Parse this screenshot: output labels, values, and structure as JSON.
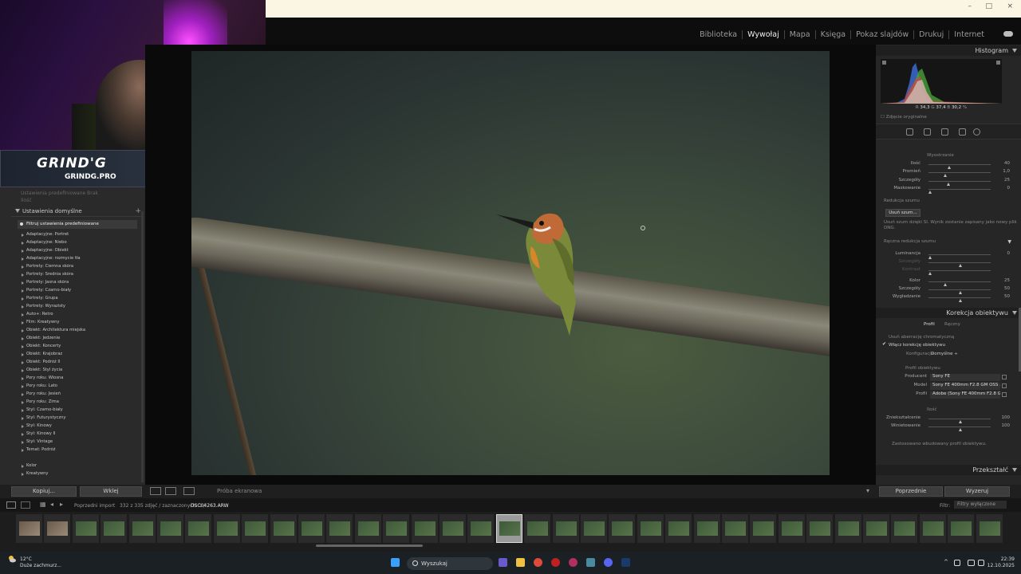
{
  "window": {
    "controls": [
      "–",
      "□",
      "×"
    ]
  },
  "modules": {
    "items": [
      "Biblioteka",
      "Wywołaj",
      "Mapa",
      "Księga",
      "Pokaz slajdów",
      "Drukuj",
      "Internet"
    ],
    "active": "Wywołaj"
  },
  "overlay": {
    "logo_big": "GRIND'G",
    "logo_small": "GRINDG.PRO"
  },
  "left_panel": {
    "faded_rows": [
      "Ustawienia predefiniowane   Brak",
      "Ilość"
    ],
    "presets_header": "Ustawienia domyślne",
    "add_symbol": "+",
    "filter_label": "Filtruj ustawienia predefiniowane",
    "presets": [
      "Adaptacyjne: Portret",
      "Adaptacyjne: Niebo",
      "Adaptacyjne: Obiekt",
      "Adaptacyjne: rozmycie tła",
      "Portrety: Ciemna skóra",
      "Portrety: Średnia skóra",
      "Portrety: Jasna skóra",
      "Portrety: Czarno-biały",
      "Portrety: Grupa",
      "Portrety: Wyrazisty",
      "Auto+: Retro",
      "Film: Kreatywny",
      "Obiekt: Architektura miejska",
      "Obiekt: Jedzenie",
      "Obiekt: Koncerty",
      "Obiekt: Krajobraz",
      "Obiekt: Podróż II",
      "Obiekt: Styl życia",
      "Pory roku: Wiosna",
      "Pory roku: Lato",
      "Pory roku: Jesień",
      "Pory roku: Zima",
      "Styl: Czarno-biały",
      "Styl: Futurystyczny",
      "Styl: Kinowy",
      "Styl: Kinowy II",
      "Styl: Vintage",
      "Temat: Podróż",
      "",
      "Kolor",
      "Kreatywny"
    ],
    "copy_button": "Kopiuj...",
    "paste_button": "Wklej"
  },
  "toolbar": {
    "soft_proof": "Próba ekranowa"
  },
  "right_panel": {
    "histogram_title": "Histogram",
    "rgb": {
      "r_label": "R",
      "r": "34,3",
      "g_label": "G",
      "g": "37,4",
      "b_label": "B",
      "b": "30,2",
      "unit": "%"
    },
    "original_photo": "Zdjęcie oryginalne",
    "sharpen_title": "Wyostrzanie",
    "sharpen": [
      {
        "name": "Ilość",
        "value": "40",
        "pos": 0.31
      },
      {
        "name": "Promień",
        "value": "1,0",
        "pos": 0.25
      },
      {
        "name": "Szczegóły",
        "value": "25",
        "pos": 0.3
      },
      {
        "name": "Maskowanie",
        "value": "0",
        "pos": 0.0
      }
    ],
    "noise_title": "Redukcja szumu",
    "denoise_button": "Usuń szum...",
    "denoise_note": "Usuń szum dzięki SI. Wynik zostanie zapisany jako nowy plik DNG.",
    "manual_noise": "Ręczna redukcja szumu",
    "noise": [
      {
        "name": "Luminancja",
        "value": "0",
        "pos": 0.0,
        "dim": false
      },
      {
        "name": "Szczegóły",
        "value": "",
        "pos": 0.5,
        "dim": true
      },
      {
        "name": "Kontrast",
        "value": "",
        "pos": 0.0,
        "dim": true
      },
      {
        "name": "Kolor",
        "value": "25",
        "pos": 0.25,
        "dim": false
      },
      {
        "name": "Szczegóły",
        "value": "50",
        "pos": 0.5,
        "dim": false
      },
      {
        "name": "Wygładzanie",
        "value": "50",
        "pos": 0.5,
        "dim": false
      }
    ],
    "lens_title": "Korekcja obiektywu",
    "lens_tabs": [
      "Profil",
      "Ręczny"
    ],
    "remove_ca": "Usuń aberrację chromatyczną",
    "enable_profile": "Włącz korekcję obiektywu",
    "setup_label": "Konfiguracja",
    "setup_value": "Domyślne ÷",
    "profile_group": "Profil obiektywu",
    "fields": [
      {
        "name": "Producent",
        "value": "Sony FE"
      },
      {
        "name": "Model",
        "value": "Sony FE 400mm F2.8 GM OSS ..."
      },
      {
        "name": "Profil",
        "value": "Adobe (Sony FE 400mm F2.8 G..."
      }
    ],
    "amount_group": "Ilość",
    "amount": [
      {
        "name": "Zniekształcenie",
        "value": "100",
        "pos": 0.5
      },
      {
        "name": "Winietowanie",
        "value": "100",
        "pos": 0.5
      }
    ],
    "builtin_note": "Zastosowano wbudowany profil obiektywu.",
    "transform_title": "Przekształć",
    "prev_button": "Poprzednie",
    "reset_button": "Wyzeruj"
  },
  "filmstrip_bar": {
    "prev_import": "Poprzedni import",
    "count": "332 z 335 zdjęć / zaznaczonych: 1 /",
    "filename": "DSC04263.ARW",
    "filter_label": "Filtr:",
    "filter_value": "Filtry wyłączone"
  },
  "filmstrip": {
    "count": 35,
    "selected": 17
  },
  "taskbar": {
    "temperature": "12°C",
    "weather": "Duże zachmurz...",
    "search": "Wyszukaj",
    "time": "22:39",
    "date": "12.10.2025"
  }
}
